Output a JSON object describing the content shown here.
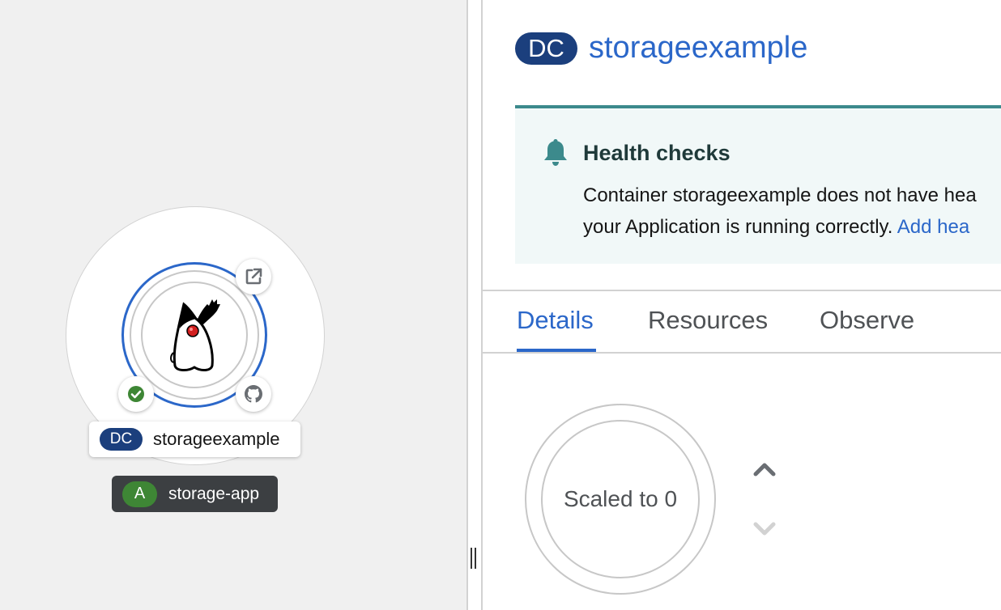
{
  "topology": {
    "node": {
      "kind_badge": "DC",
      "name": "storageexample",
      "runtime_icon": "java-duke-icon",
      "status": "healthy"
    },
    "decorators": {
      "open_url": "external-link-icon",
      "build_status": "check-circle-icon",
      "source_repo": "github-icon"
    },
    "application_group": {
      "badge": "A",
      "name": "storage-app"
    }
  },
  "side_panel": {
    "kind_badge": "DC",
    "title": "storageexample",
    "alert": {
      "title": "Health checks",
      "line1": "Container storageexample does not have hea",
      "line2": "your Application is running correctly. ",
      "link": "Add hea"
    },
    "tabs": [
      {
        "label": "Details",
        "active": true
      },
      {
        "label": "Resources",
        "active": false
      },
      {
        "label": "Observe",
        "active": false
      }
    ],
    "pod_ring_label": "Scaled to 0",
    "scale_up": "chevron-up-icon",
    "scale_down": "chevron-down-icon"
  },
  "colors": {
    "brand_blue": "#2b67c9",
    "dc_badge": "#1b3f7d",
    "app_badge": "#3e8635",
    "success": "#3e8635",
    "alert_teal": "#3c8a8c",
    "alert_bg": "#f1f8f8",
    "topology_bg": "#f0f0f0"
  }
}
